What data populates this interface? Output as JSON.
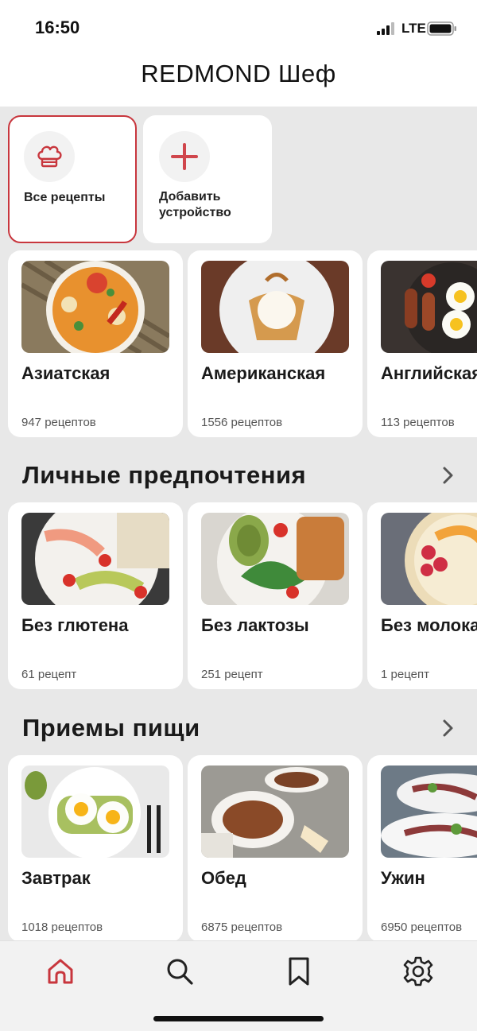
{
  "status_bar": {
    "time": "16:50",
    "network": "LTE"
  },
  "header": {
    "title": "REDMOND Шеф"
  },
  "quick_actions": [
    {
      "label": "Все рецепты",
      "icon": "chef-hat-icon",
      "selected": true
    },
    {
      "label": "Добавить устройство",
      "icon": "plus-icon",
      "selected": false
    }
  ],
  "cuisines": [
    {
      "name": "Азиатская",
      "count": "947 рецептов"
    },
    {
      "name": "Американская",
      "count": "1556 рецептов"
    },
    {
      "name": "Английская",
      "count": "113 рецептов"
    }
  ],
  "preferences": {
    "title": "Личные предпочтения",
    "items": [
      {
        "name": "Без глютена",
        "count": "61 рецепт"
      },
      {
        "name": "Без лактозы",
        "count": "251 рецепт"
      },
      {
        "name": "Без молока",
        "count": "1 рецепт"
      }
    ]
  },
  "meals": {
    "title": "Приемы пищи",
    "items": [
      {
        "name": "Завтрак",
        "count": "1018 рецептов"
      },
      {
        "name": "Обед",
        "count": "6875 рецептов"
      },
      {
        "name": "Ужин",
        "count": "6950 рецептов"
      }
    ]
  },
  "tabbar": [
    {
      "icon": "home-icon",
      "active": true
    },
    {
      "icon": "search-icon",
      "active": false
    },
    {
      "icon": "bookmark-icon",
      "active": false
    },
    {
      "icon": "settings-icon",
      "active": false
    }
  ],
  "colors": {
    "accent": "#c8363d",
    "background": "#e8e8e8",
    "card": "#ffffff"
  }
}
